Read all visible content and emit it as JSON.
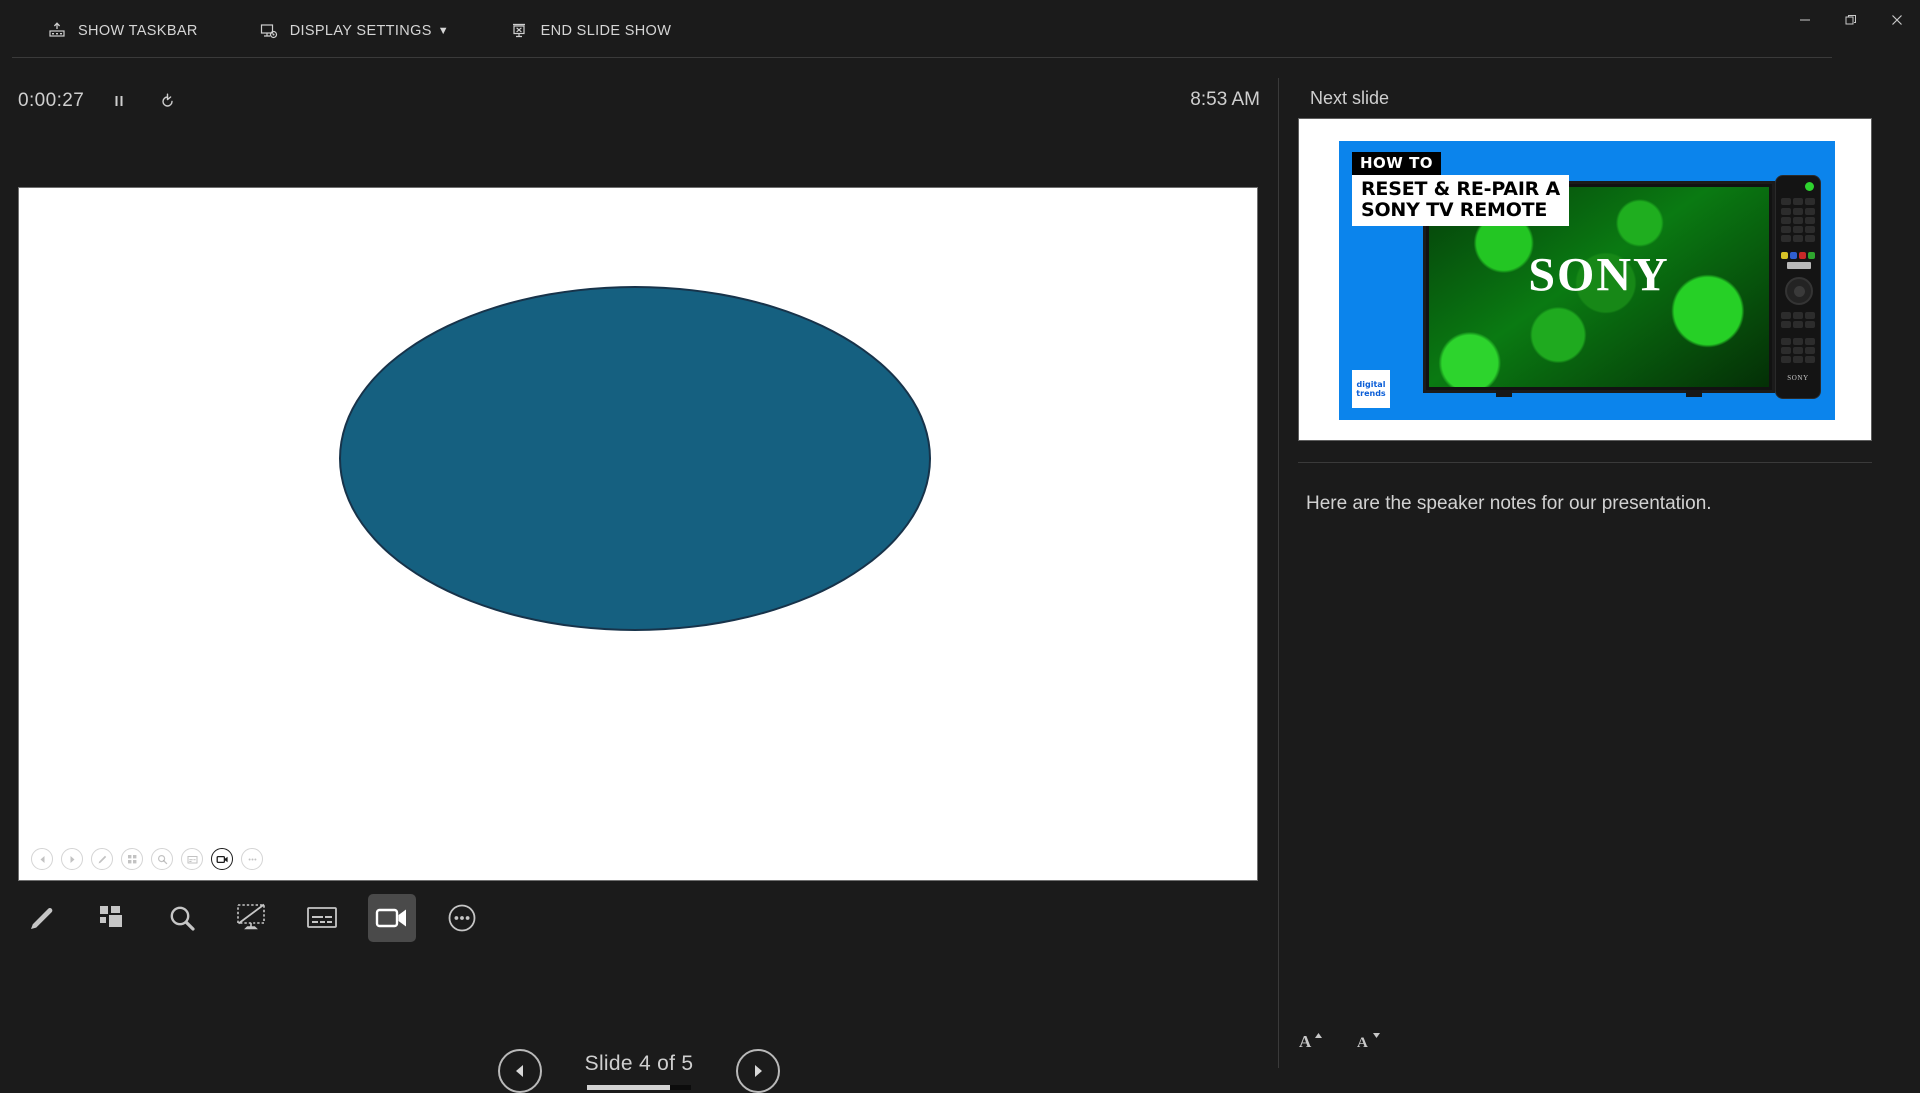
{
  "window": {
    "minimize_label": "—",
    "restore_label": "❐",
    "close_label": "✕"
  },
  "top_bar": {
    "commands": [
      {
        "label": "SHOW TASKBAR",
        "icon": "show-taskbar-icon"
      },
      {
        "label": "DISPLAY SETTINGS",
        "icon": "display-settings-icon",
        "caret": "▼"
      },
      {
        "label": "END SLIDE SHOW",
        "icon": "end-slide-show-icon"
      }
    ]
  },
  "timer": {
    "value": "0:00:27",
    "pause_icon": "pause-icon",
    "restart_icon": "restart-icon"
  },
  "clock": {
    "time": "8:53 AM"
  },
  "current_slide": {
    "shape": "ellipse",
    "fill_color": "#156080",
    "outline_color": "#17334a",
    "background": "#ffffff"
  },
  "inslide_toolbar": {
    "buttons": [
      {
        "name": "previous-slide-mini",
        "icon": "triangle-left-icon",
        "active": false
      },
      {
        "name": "next-slide-mini",
        "icon": "triangle-right-icon",
        "active": false
      },
      {
        "name": "pen-mini",
        "icon": "pen-icon",
        "active": false
      },
      {
        "name": "all-slides-mini",
        "icon": "grid-icon",
        "active": false
      },
      {
        "name": "zoom-mini",
        "icon": "magnifier-icon",
        "active": false
      },
      {
        "name": "subtitles-mini",
        "icon": "subtitles-icon",
        "active": false
      },
      {
        "name": "camera-mini",
        "icon": "camera-icon",
        "active": true
      },
      {
        "name": "more-options-mini",
        "icon": "ellipsis-icon",
        "active": false
      }
    ]
  },
  "presenter_toolbar": {
    "tools": [
      {
        "name": "pen-tool",
        "icon": "pen-icon",
        "active": false
      },
      {
        "name": "all-slides-tool",
        "icon": "grid-icon",
        "active": false
      },
      {
        "name": "zoom-tool",
        "icon": "magnifier-icon",
        "active": false
      },
      {
        "name": "black-screen-tool",
        "icon": "blank-screen-icon",
        "active": false
      },
      {
        "name": "subtitles-tool",
        "icon": "subtitles-icon",
        "active": false
      },
      {
        "name": "camera-tool",
        "icon": "camera-icon",
        "active": true
      },
      {
        "name": "more-options-tool",
        "icon": "ellipsis-icon",
        "active": false
      }
    ]
  },
  "navigation": {
    "previous_icon": "triangle-left-icon",
    "next_icon": "triangle-right-icon",
    "counter_text": "Slide 4 of 5",
    "current_slide_number": 4,
    "total_slides": 5,
    "progress_percent": 80
  },
  "next_slide_panel": {
    "header": "Next slide",
    "thumbnail": {
      "howto_chip": "HOW TO",
      "title_line_1": "RESET & RE-PAIR A",
      "title_line_2": "SONY TV REMOTE",
      "tv_brand": "SONY",
      "remote_brand": "SONY",
      "logo_line_1": "digital",
      "logo_line_2": "trends",
      "background_color": "#0b84ec",
      "screen_color": "#0a7a12"
    }
  },
  "speaker_notes": {
    "text": "Here are the speaker notes for our presentation."
  },
  "font_size_controls": {
    "increase": {
      "letter": "A",
      "arrow": "▲",
      "name": "increase-font-size"
    },
    "decrease": {
      "letter": "A",
      "arrow": "▼",
      "name": "decrease-font-size"
    }
  }
}
